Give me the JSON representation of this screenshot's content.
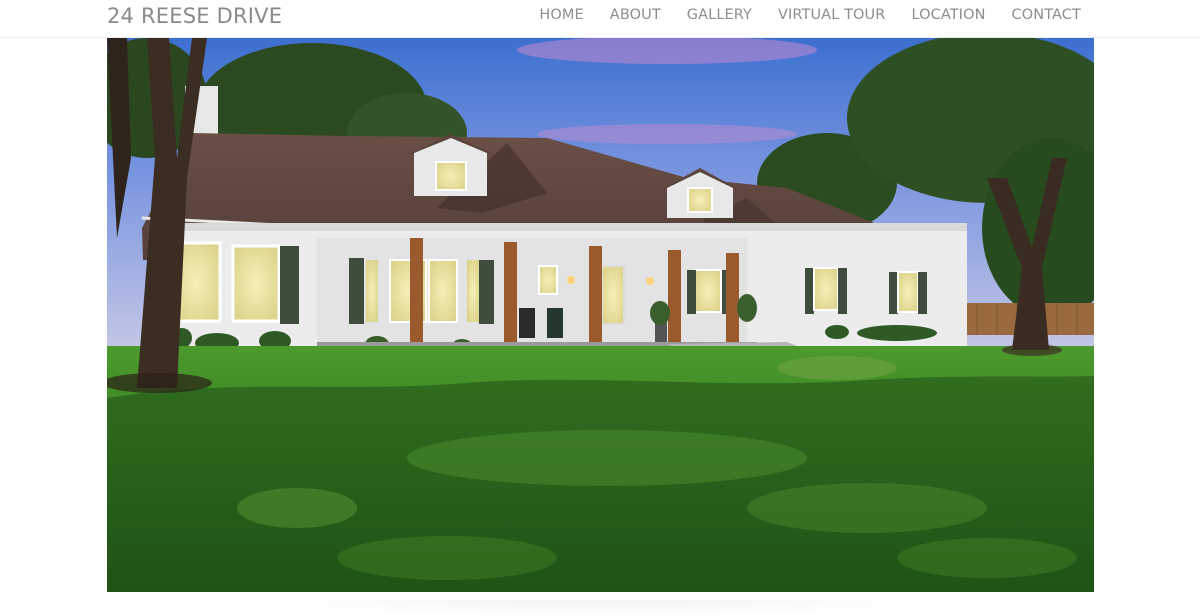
{
  "header": {
    "site_title": "24 REESE DRIVE",
    "nav": [
      {
        "label": "HOME"
      },
      {
        "label": "ABOUT"
      },
      {
        "label": "GALLERY"
      },
      {
        "label": "VIRTUAL TOUR"
      },
      {
        "label": "LOCATION"
      },
      {
        "label": "CONTACT"
      }
    ]
  },
  "colors": {
    "header_text": "#8a8a8a",
    "nav_text": "#8e8e8e",
    "sky_top": "#3e6fcf",
    "roof": "#5e463d",
    "lawn": "#3f8a26"
  },
  "hero": {
    "image_name": "house-exterior-photo"
  }
}
